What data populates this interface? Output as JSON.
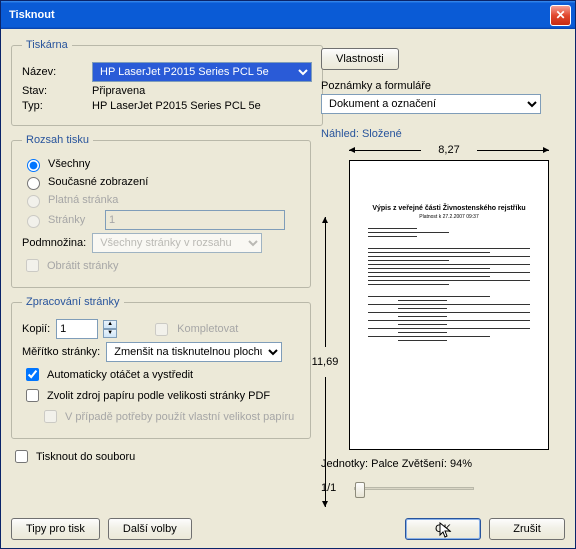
{
  "window": {
    "title": "Tisknout"
  },
  "printer": {
    "group": "Tiskárna",
    "name_lbl": "Název:",
    "name_val": "HP LaserJet P2015 Series PCL 5e",
    "status_lbl": "Stav:",
    "status_val": "Připravena",
    "type_lbl": "Typ:",
    "type_val": "HP LaserJet P2015 Series PCL 5e",
    "props_btn": "Vlastnosti",
    "comments_lbl": "Poznámky a formuláře",
    "comments_val": "Dokument a označení"
  },
  "range": {
    "group": "Rozsah tisku",
    "all": "Všechny",
    "view": "Současné zobrazení",
    "currpage": "Platná stránka",
    "pages_lbl": "Stránky",
    "pages_val": "1",
    "subset_lbl": "Podmnožina:",
    "subset_val": "Všechny stránky v rozsahu",
    "reverse": "Obrátit stránky"
  },
  "handling": {
    "group": "Zpracování stránky",
    "copies_lbl": "Kopií:",
    "copies_val": "1",
    "collate": "Kompletovat",
    "scale_lbl": "Měřítko stránky:",
    "scale_val": "Zmenšit na tisknutelnou plochu",
    "autorotate": "Automaticky otáčet a vystředit",
    "paper": "Zvolit zdroj papíru podle velikosti stránky PDF",
    "custom": "V případě potřeby použít vlastní velikost papíru"
  },
  "printfile": "Tisknout do souboru",
  "preview": {
    "title": "Náhled: Složené",
    "width": "8,27",
    "height": "11,69",
    "units": "Jednotky: Palce Zvětšení:  94%",
    "page": "1/1",
    "doc_title": "Výpis z veřejné části Živnostenského rejstříku"
  },
  "buttons": {
    "tips": "Tipy pro tisk",
    "adv": "Další volby",
    "ok": "OK",
    "cancel": "Zrušit"
  }
}
